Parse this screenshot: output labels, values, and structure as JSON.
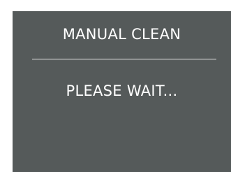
{
  "screen": {
    "title": "MANUAL CLEAN",
    "message": "PLEASE WAIT...",
    "background_color": "#555a5a",
    "text_color": "#ffffff"
  }
}
